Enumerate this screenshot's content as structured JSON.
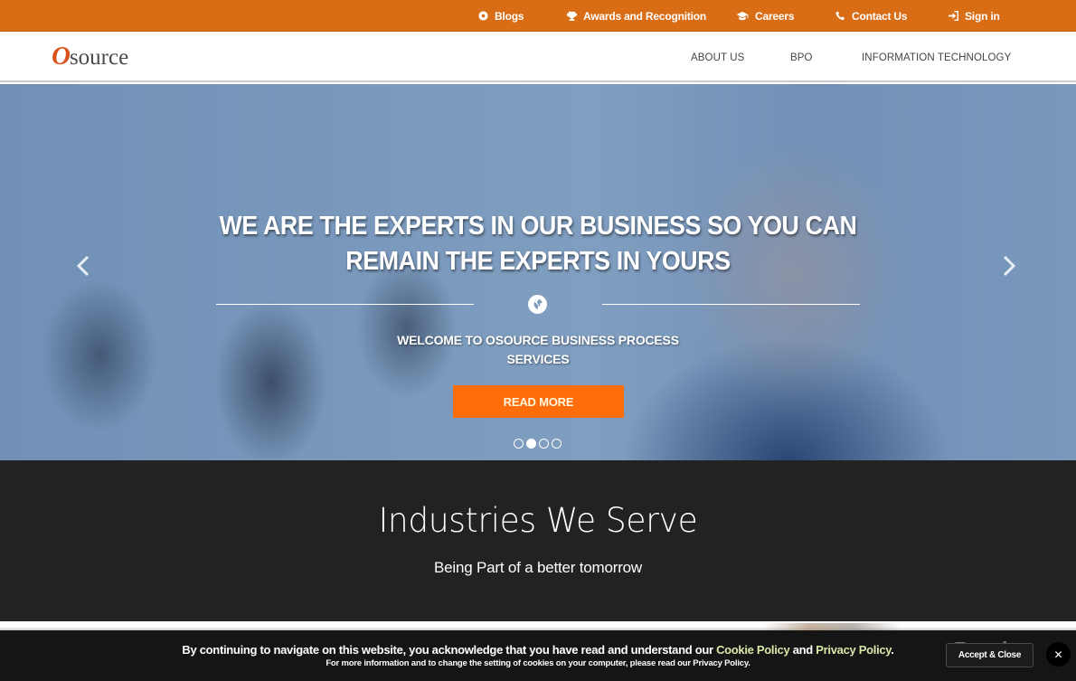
{
  "topbar": {
    "links": [
      {
        "label": "Blogs",
        "icon": "blog-icon"
      },
      {
        "label": "Awards and Recognition",
        "icon": "trophy-icon"
      },
      {
        "label": "Careers",
        "icon": "graduation-cap-icon"
      },
      {
        "label": "Contact Us",
        "icon": "phone-icon"
      },
      {
        "label": "Sign in",
        "icon": "sign-in-icon"
      }
    ]
  },
  "header": {
    "logo": {
      "first_letter": "O",
      "rest": "source"
    },
    "nav": [
      {
        "label": "ABOUT US"
      },
      {
        "label": "BPO"
      },
      {
        "label": "INFORMATION TECHNOLOGY"
      }
    ]
  },
  "hero": {
    "heading_line1": "WE ARE THE EXPERTS IN OUR BUSINESS SO YOU CAN",
    "heading_line2": "REMAIN THE EXPERTS IN YOURS",
    "divider_icon": "globe-icon",
    "subheading_line1": "WELCOME TO OSOURCE BUSINESS PROCESS",
    "subheading_line2": "SERVICES",
    "cta_label": "READ MORE",
    "prev_icon": "chevron-left-icon",
    "next_icon": "chevron-right-icon",
    "slides_total": 4,
    "active_slide": 2
  },
  "industries": {
    "title": "Industries We Serve",
    "subtitle": "Being Part of a better tomorrow"
  },
  "cookie_banner": {
    "text_before": "By continuing to navigate on this website, you acknowledge that you have read and understand our ",
    "cookie_policy_link": "Cookie Policy",
    "text_and": " and ",
    "privacy_policy_link": "Privacy Policy",
    "text_end": ".",
    "small_text": "For more information and to change the setting of cookies on your computer, please read our Privacy Policy.",
    "accept_label": "Accept & Close",
    "close_icon": "close-icon",
    "link_color": "#d7e8a8"
  },
  "watermark": "Revain",
  "colors": {
    "topbar_bg": "#d96d16",
    "cta_bg": "#ff6c0a",
    "industries_bg": "#222222",
    "cookie_bg": "#151515",
    "logo_accent": "#d9541c"
  }
}
